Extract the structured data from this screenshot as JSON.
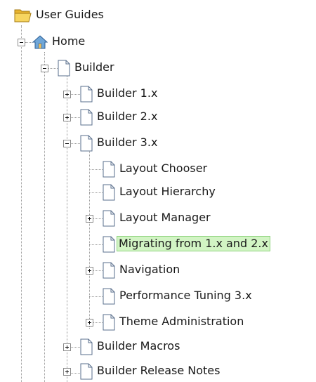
{
  "tree": {
    "root": {
      "label": "User Guides",
      "icon": "folder-open-icon"
    },
    "home": {
      "label": "Home",
      "icon": "home-icon"
    },
    "builder": {
      "label": "Builder"
    },
    "builder_children": [
      {
        "label": "Builder 1.x"
      },
      {
        "label": "Builder 2.x"
      },
      {
        "label": "Builder 3.x"
      }
    ],
    "builder3_children": [
      {
        "label": "Layout Chooser"
      },
      {
        "label": "Layout Hierarchy"
      },
      {
        "label": "Layout Manager"
      },
      {
        "label": "Migrating from 1.x and 2.x",
        "selected": true
      },
      {
        "label": "Navigation"
      },
      {
        "label": "Performance Tuning 3.x"
      },
      {
        "label": "Theme Administration"
      }
    ],
    "builder_more": [
      {
        "label": "Builder Macros"
      },
      {
        "label": "Builder Release Notes"
      }
    ]
  },
  "colors": {
    "selected_bg": "#d2f4c4",
    "selected_border": "#8fd47f",
    "connector": "#9a9a9a"
  }
}
